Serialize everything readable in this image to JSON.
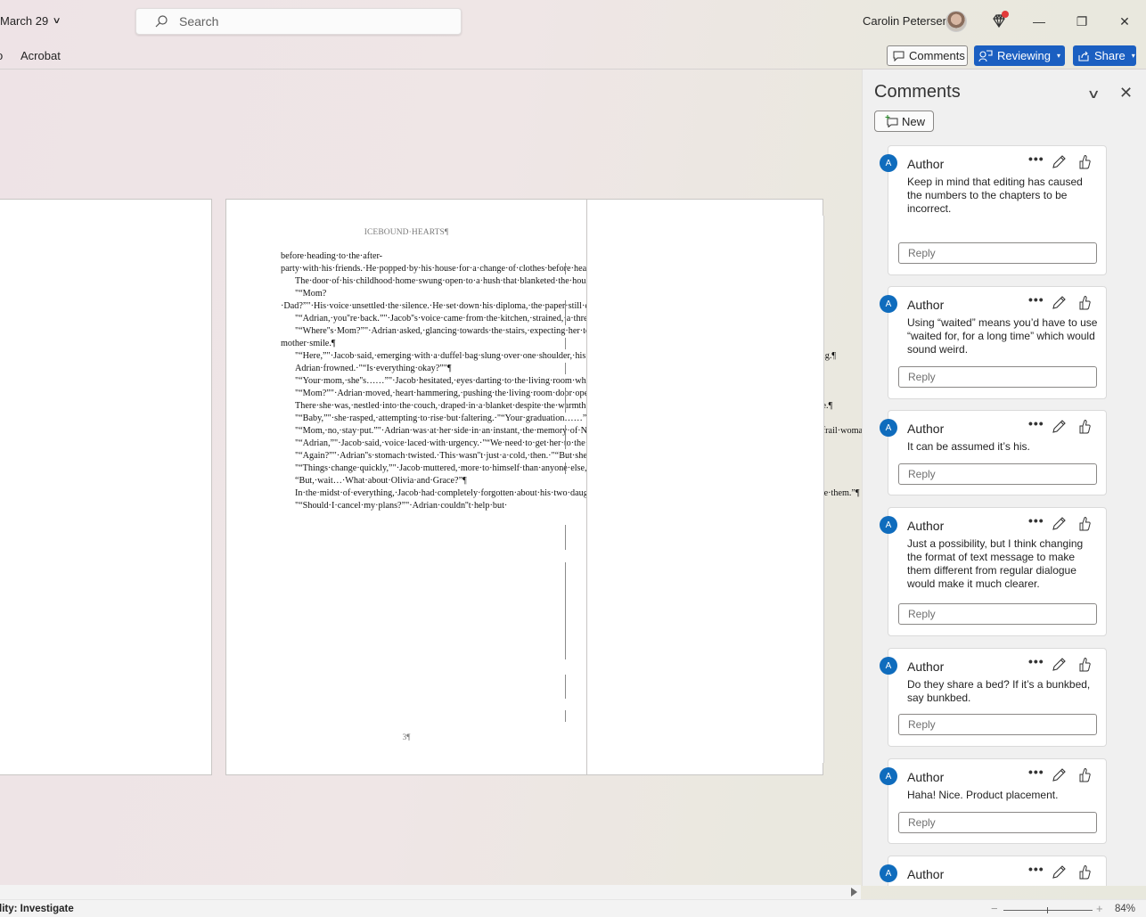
{
  "titlebar": {
    "doc_title": "March 29",
    "search_placeholder": "Search",
    "user_name": "Carolin Petersen",
    "window_controls": {
      "minimize": "—",
      "restore": "❐",
      "close": "✕"
    }
  },
  "ribbon": {
    "tab_partial": "o",
    "tab_acrobat": "Acrobat",
    "comments_label": "Comments",
    "reviewing_label": "Reviewing",
    "share_label": "Share"
  },
  "document": {
    "header": "ICEBOUND·HEARTS¶",
    "page_number": "3¶",
    "paragraphs": [
      {
        "indent": false,
        "text": "before·heading·to·the·after-party·with·his·friends.·He·popped·by·his·house·for·a·change·of·clothes·before·heading·back.·¶"
      },
      {
        "indent": true,
        "text": "The·door·of·his·childhood·home·swung·open·to·a·hush·that·blanketed·the·house.¶"
      },
      {
        "indent": true,
        "text": "\"“Mom?·Dad?”\"·His·voice·unsettled·the·silence.·He·set·down·his·diploma,·the·paper·still·crisp,·unmarred·by·life''s·inevitable·creases.¶"
      },
      {
        "indent": true,
        "text": "\"“Adrian,·you''re·back.”\"·Jacob''s·voice·came·from·the·kitchen,·strained,·a·thread·pulled·too·taut.¶"
      },
      {
        "indent": true,
        "text": "\"“Where''s·Mom?”\"·Adrian·asked,·glancing·towards·the·stairs,·expecting·her·to·appear·with·that·proud-mother·smile.¶"
      },
      {
        "indent": true,
        "text": "\"“Here,”\"·Jacob·said,·emerging·with·a·duffel·bag·slung·over·one·shoulder,·his·face·etched·with·worry·lines·that·hadn''t·been·there·that·morning.¶"
      },
      {
        "indent": true,
        "text": "Adrian·frowned.·\"“Is·everything·okay?”\"¶"
      },
      {
        "indent": true,
        "text": "\"“Your·mom,·she''s……”\"·Jacob·hesitated,·eyes·darting·to·the·living·room·where·coughs·disrupted·the·quiet.¶"
      },
      {
        "indent": true,
        "text": "\"“Mom?”\"·Adrian·moved,·heart·hammering,·pushing·the·living·room·door·open.¶"
      },
      {
        "indent": true,
        "text": "There·she·was,·nestled·into·the·couch,·draped·in·a·blanket·despite·the·warmth·of·June.·Her·chest·rose·and·fell·with·effort,·each·breath·a·battle.¶"
      },
      {
        "indent": true,
        "text": "\"“Baby,”\"·she·rasped,·attempting·to·rise·but·faltering.·\"“Your·graduation……”\"¶"
      },
      {
        "indent": true,
        "text": "\"“Mom,·no,·stay·put.”\"·Adrian·was·at·her·side·in·an·instant,·the·memory·of·Nina''s·smile·dissolving·into·the·air,·replaced·by·concern·for·the·frail·woman·before·him.¶"
      },
      {
        "indent": true,
        "text": "\"“Adrian,”\"·Jacob·said,·voice·laced·with·urgency.·\"“We·need·to·get·her·to·the·hospital.”\"¶"
      },
      {
        "indent": true,
        "text": "\"“Again?”\"·Adrian''s·stomach·twisted.·This·wasn''t·just·a·cold,·then.·\"“But·she·was·fine·this·morning.”\"¶"
      },
      {
        "indent": true,
        "text": "\"“Things·change·quickly,”\"·Jacob·muttered,·more·to·himself·than·anyone·else,·checking·his·watch.¶"
      },
      {
        "indent": true,
        "text": "“But,·wait…·What·about·Olivia·and·Grace?”¶"
      },
      {
        "indent": true,
        "text": "In·the·midst·of·everything,·Jacob·had·completely·forgotten·about·his·two·daughters.·“Shit.·Tthey''are·upstairs·sleeping.·I·should·probably·wake·them.”¶"
      },
      {
        "indent": true,
        "text": "\"“Should·I·cancel·my·plans?”\"·Adrian·couldn''t·help·but·"
      }
    ]
  },
  "comments_pane": {
    "title": "Comments",
    "new_label": "New",
    "comments": [
      {
        "avatar": "A",
        "author": "Author",
        "text": "Keep in mind that editing has caused the numbers to the chapters to be incorrect.",
        "reply_placeholder": "Reply"
      },
      {
        "avatar": "A",
        "author": "Author",
        "text": "Using “waited” means you’d have to use “waited for, for a long time” which would sound weird.",
        "reply_placeholder": "Reply"
      },
      {
        "avatar": "A",
        "author": "Author",
        "text": "It can be assumed it’s his.",
        "reply_placeholder": "Reply"
      },
      {
        "avatar": "A",
        "author": "Author",
        "text": "Just a possibility, but I think changing the format of text message to make them different from regular dialogue would make it much clearer.",
        "reply_placeholder": "Reply"
      },
      {
        "avatar": "A",
        "author": "Author",
        "text": "Do they share a bed? If it’s a bunkbed, say bunkbed.",
        "reply_placeholder": "Reply"
      },
      {
        "avatar": "A",
        "author": "Author",
        "text": "Haha! Nice. Product placement.",
        "reply_placeholder": "Reply"
      },
      {
        "avatar": "A",
        "author": "Author",
        "text": "",
        "reply_placeholder": ""
      }
    ]
  },
  "statusbar": {
    "accessibility": "lity: Investigate",
    "zoom_level": "84%",
    "zoom_fraction": 0.49
  },
  "colors": {
    "accent_blue": "#1b5fc1",
    "avatar_blue": "#0f6cbd",
    "revision_blue": "#1f6fc4",
    "notification_red": "#e23a3a"
  }
}
